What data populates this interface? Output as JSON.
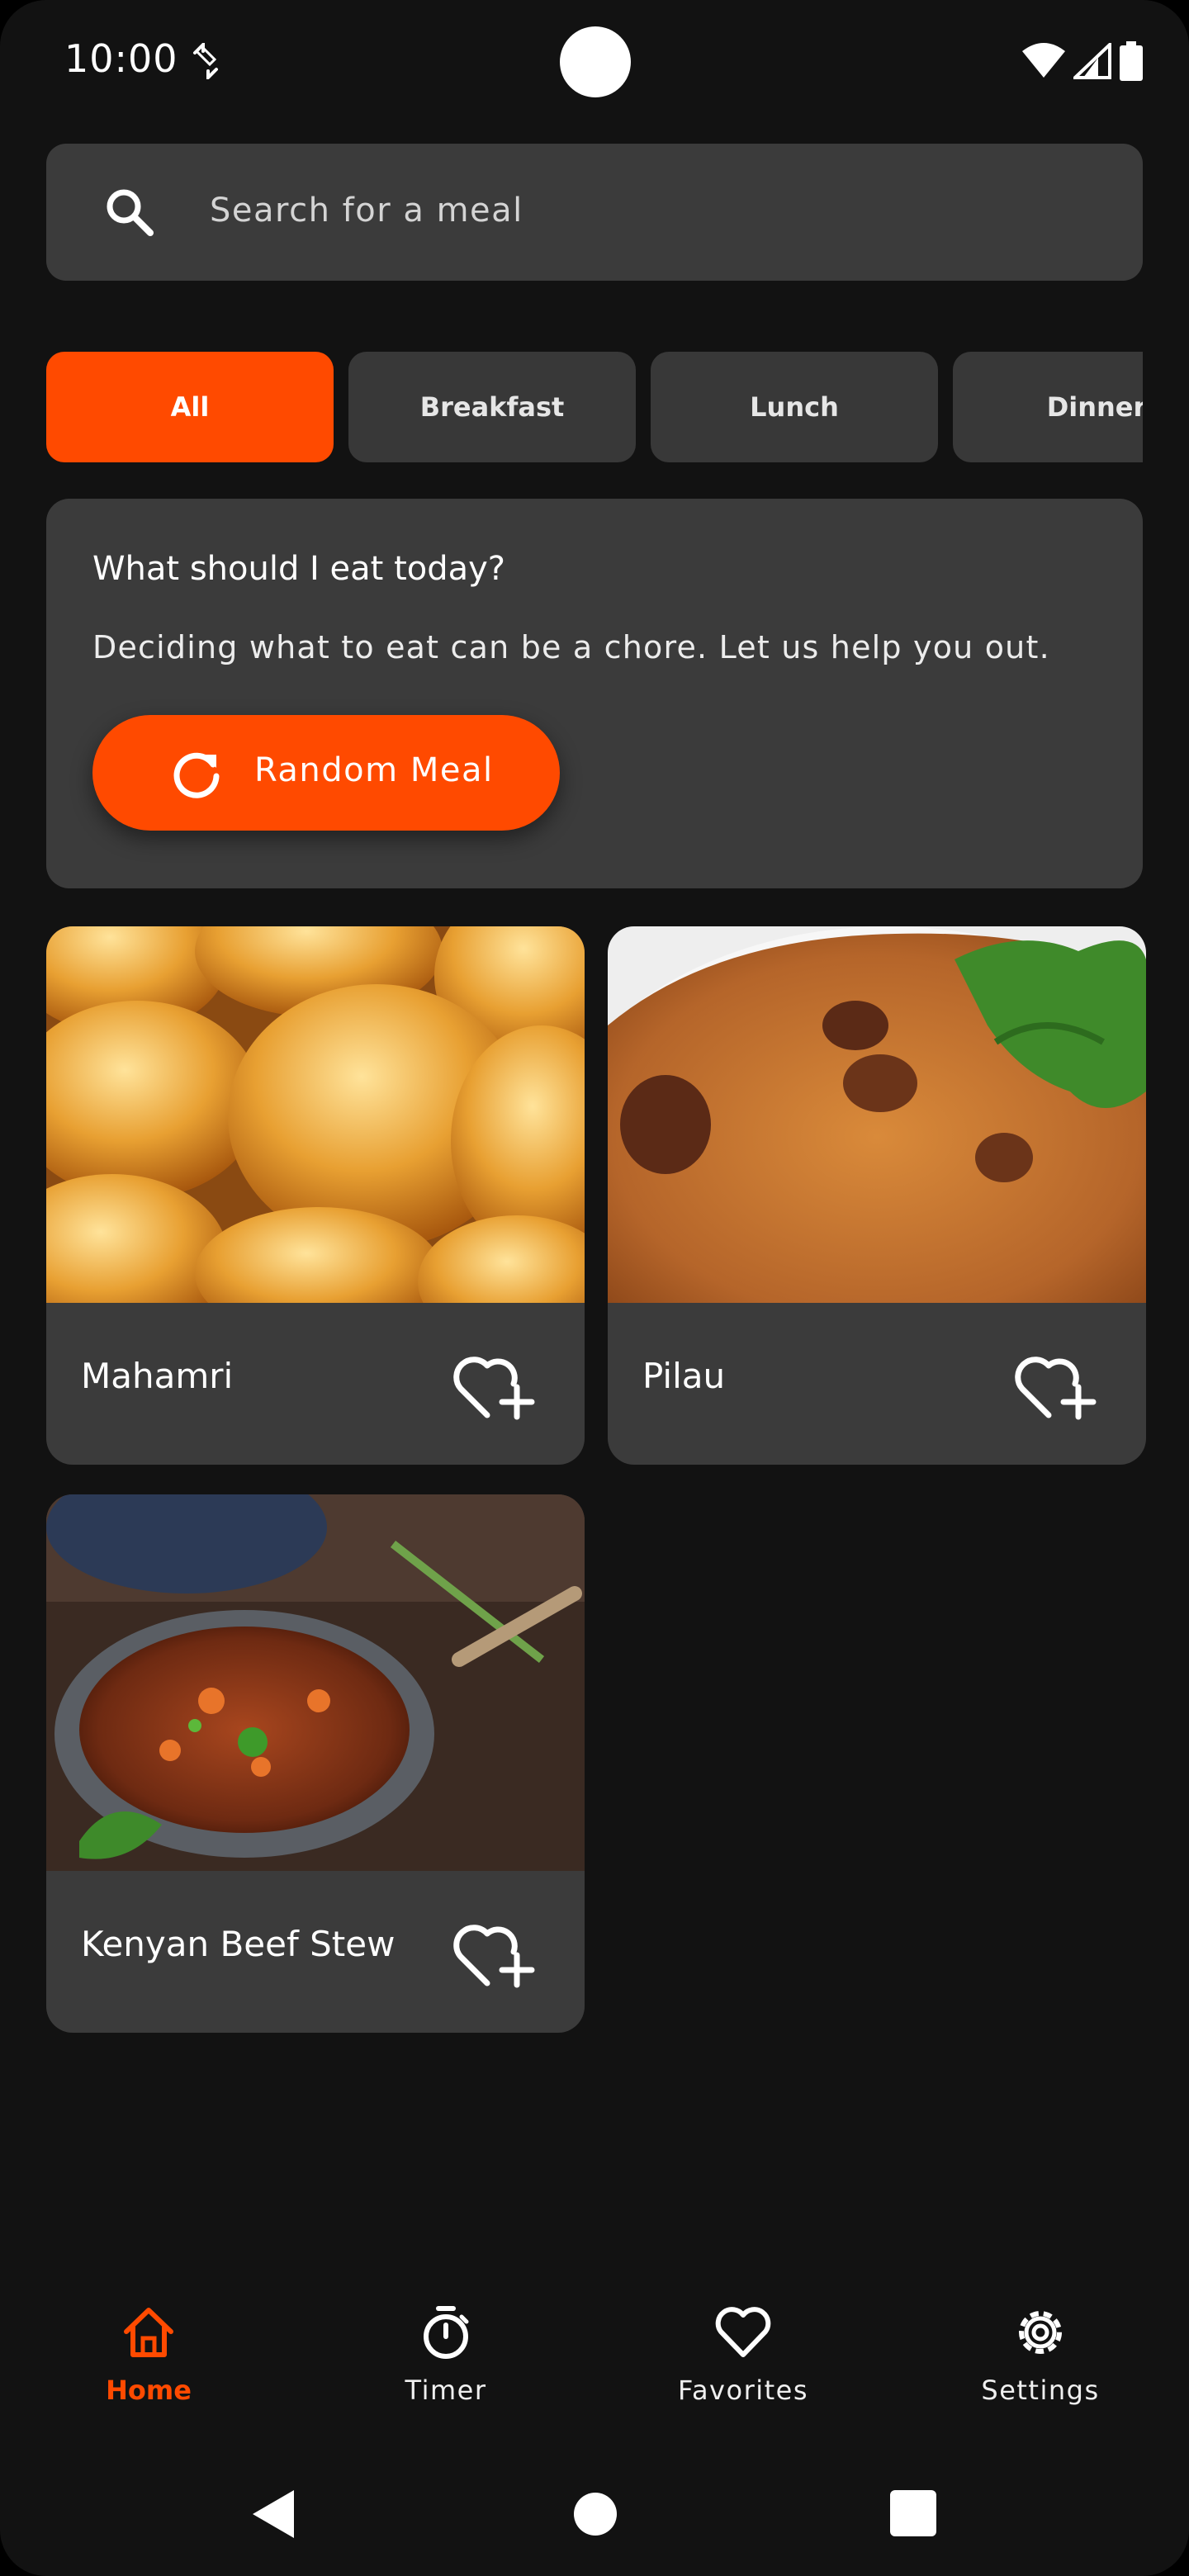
{
  "status_bar": {
    "time": "10:00"
  },
  "search": {
    "placeholder": "Search for a meal"
  },
  "categories": [
    {
      "label": "All",
      "active": true
    },
    {
      "label": "Breakfast",
      "active": false
    },
    {
      "label": "Lunch",
      "active": false
    },
    {
      "label": "Dinner",
      "active": false
    }
  ],
  "promo": {
    "title": "What should I eat today?",
    "description": "Deciding what to eat can be a chore. Let us help you out.",
    "button_label": "Random Meal"
  },
  "meals": [
    {
      "name": "Mahamri",
      "favorite_icon": "heart-plus-icon"
    },
    {
      "name": "Pilau",
      "favorite_icon": "heart-plus-icon"
    },
    {
      "name": "Kenyan Beef Stew",
      "favorite_icon": "heart-plus-icon"
    }
  ],
  "bottom_nav": [
    {
      "label": "Home",
      "icon": "home-icon",
      "active": true
    },
    {
      "label": "Timer",
      "icon": "timer-icon",
      "active": false
    },
    {
      "label": "Favorites",
      "icon": "heart-icon",
      "active": false
    },
    {
      "label": "Settings",
      "icon": "gear-icon",
      "active": false
    }
  ],
  "colors": {
    "accent": "#ff4a00",
    "background": "#121212",
    "surface": "#3b3b3b"
  }
}
